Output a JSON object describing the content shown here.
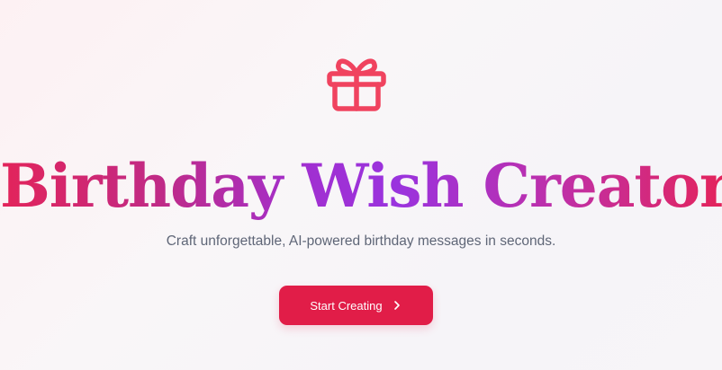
{
  "hero": {
    "icon": "gift-icon",
    "title": "Birthday Wish Creator",
    "subtitle": "Craft unforgettable, AI-powered birthday messages in seconds.",
    "cta_label": "Start Creating",
    "cta_icon": "chevron-right-icon"
  },
  "colors": {
    "accent": "#e11d48",
    "title_gradient": [
      "#e3245a",
      "#a12fd0",
      "#e3245c"
    ],
    "subtitle": "#5f6677",
    "icon": "#f0435f"
  }
}
